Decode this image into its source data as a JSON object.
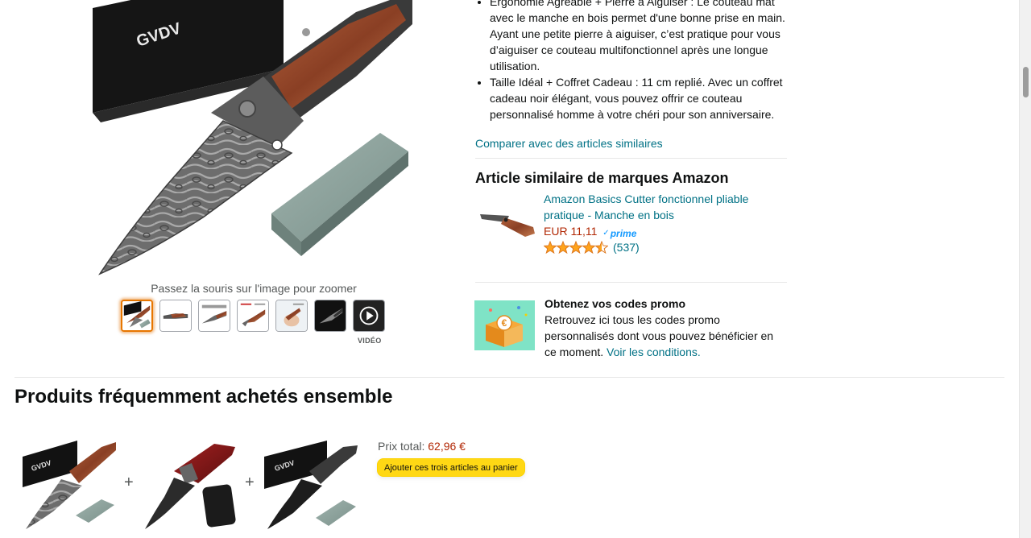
{
  "gallery": {
    "brand_text": "GVDV",
    "zoom_hint": "Passez la souris sur l'image pour zoomer",
    "video_label": "VIDÉO",
    "thumbnails": [
      "knife-with-stone",
      "folded-knife",
      "knife-side-view",
      "knife-features",
      "knife-in-hand",
      "knife-on-dark",
      "video-play"
    ]
  },
  "bullets": [
    "Ergonomie Agréable + Pierre à Aiguiser : Le couteau mat avec le manche en bois permet d'une bonne prise en main. Ayant une petite pierre à aiguiser, c’est pratique pour vous d’aiguiser ce couteau multifonctionnel après une longue utilisation.",
    "Taille Idéal + Coffret Cadeau : 11 cm replié. Avec un coffret cadeau noir élégant, vous pouvez offrir ce couteau personnalisé homme à votre chéri pour son anniversaire."
  ],
  "compare_link": "Comparer avec des articles similaires",
  "similar": {
    "heading": "Article similaire de marques Amazon",
    "title": "Amazon Basics Cutter fonctionnel pliable pratique - Manche en bois",
    "price": "EUR 11,11",
    "prime_label": "prime",
    "rating": 4.5,
    "review_count": "(537)"
  },
  "promo": {
    "title": "Obtenez vos codes promo",
    "text": "Retrouvez ici tous les codes promo personnalisés dont vous pouvez bénéficier en ce moment.",
    "link": "Voir les conditions."
  },
  "fbt": {
    "heading": "Produits fréquemment achetés ensemble",
    "plus": "+",
    "total_label": "Prix total:",
    "total_value": "62,96 €",
    "button_label": "Ajouter ces trois articles au panier"
  },
  "colors": {
    "link": "#007185",
    "price": "#b12704",
    "button": "#ffd814",
    "star": "#ffa41c",
    "prime": "#1399ff"
  }
}
